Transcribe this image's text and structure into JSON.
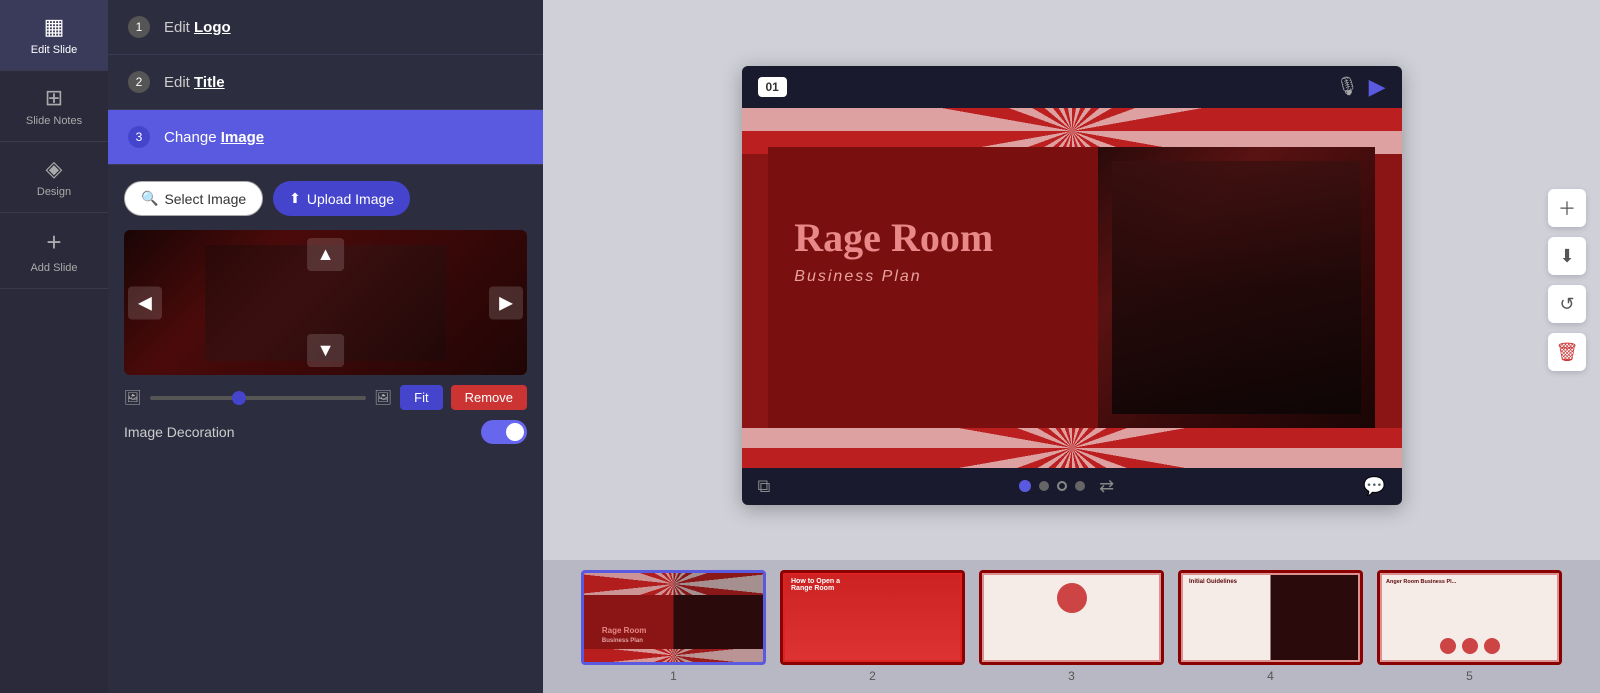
{
  "sidebar": {
    "items": [
      {
        "label": "Edit Slide",
        "icon": "▦"
      },
      {
        "label": "Slide Notes",
        "icon": "⊞"
      },
      {
        "label": "Design",
        "icon": "◈"
      },
      {
        "label": "Add Slide",
        "icon": "+"
      }
    ]
  },
  "steps": [
    {
      "num": "1",
      "prefix": "Edit ",
      "keyword": "Logo",
      "active": false
    },
    {
      "num": "2",
      "prefix": "Edit ",
      "keyword": "Title",
      "active": false
    },
    {
      "num": "3",
      "prefix": "Change ",
      "keyword": "Image",
      "active": true
    }
  ],
  "imageEditor": {
    "selectLabel": "Select Image",
    "uploadLabel": "Upload Image",
    "fitLabel": "Fit",
    "removeLabel": "Remove",
    "decorationLabel": "Image Decoration",
    "toggleOn": true
  },
  "slideViewer": {
    "badge": "01",
    "title": "Rage Room",
    "subtitle": "Business  Plan",
    "dots": [
      {
        "active": true
      },
      {
        "active": false
      },
      {
        "active": false,
        "outline": true
      },
      {
        "active": false
      }
    ]
  },
  "thumbnails": [
    {
      "num": "1",
      "selected": true,
      "topText": "Rage Room",
      "bottomText": "Business Plan"
    },
    {
      "num": "2",
      "selected": false
    },
    {
      "num": "3",
      "selected": false
    },
    {
      "num": "4",
      "selected": false,
      "topLabel": "Initial Guidelines"
    },
    {
      "num": "5",
      "selected": false,
      "topLabel": "Anger Room Business Pl..."
    }
  ]
}
